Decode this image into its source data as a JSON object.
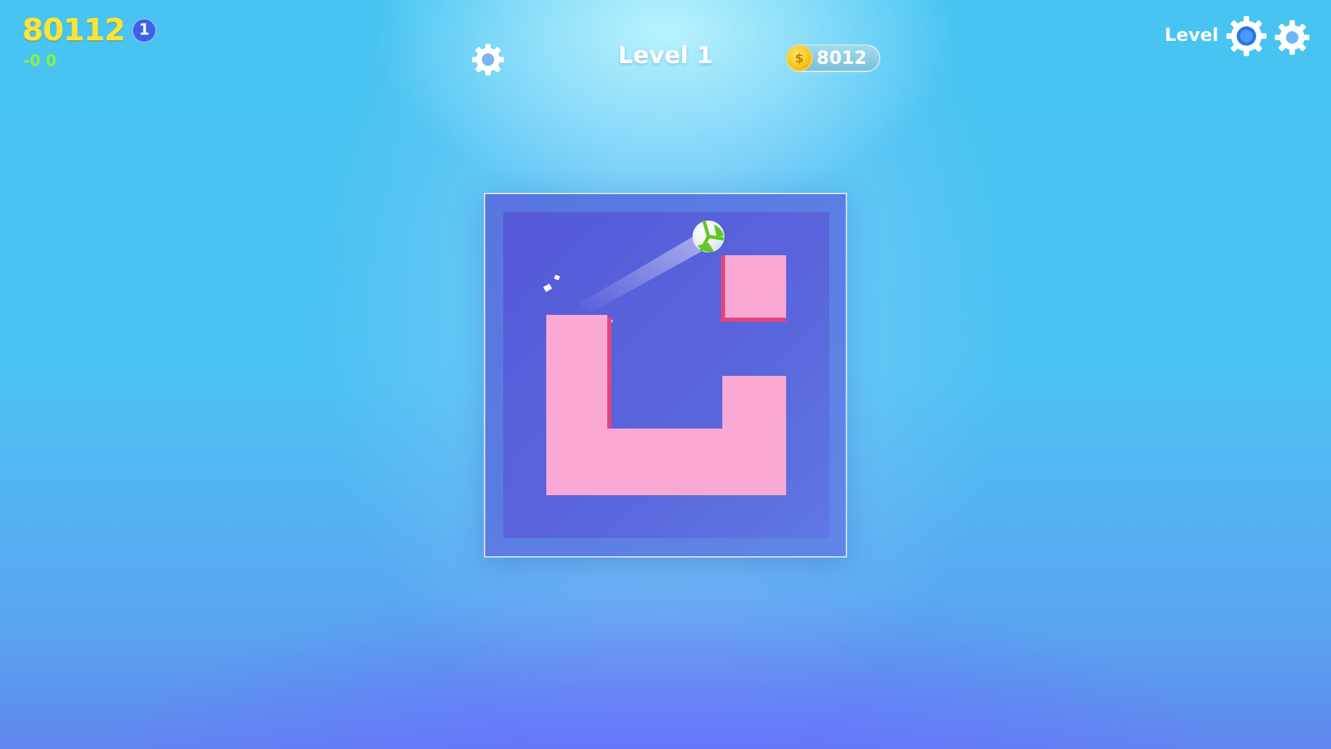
{
  "hud": {
    "score": "80112",
    "score_badge": "1",
    "sub_score": "-0 0"
  },
  "header": {
    "level_title": "Level 1",
    "coins": "8012",
    "coin_symbol": "$",
    "level_small": "Level"
  },
  "icons": {
    "settings": "gear-icon",
    "settings_right": "gear-icon",
    "level_indicator": "gear-ring-icon",
    "coin": "coin-icon"
  },
  "colors": {
    "score": "#ffe533",
    "sub_score": "#8cf23b",
    "board": "#5559d8",
    "blocks": "#f9a9d4",
    "block_edge": "#e0467d",
    "ball": "#ffffff",
    "ball_stripe": "#63c626"
  }
}
